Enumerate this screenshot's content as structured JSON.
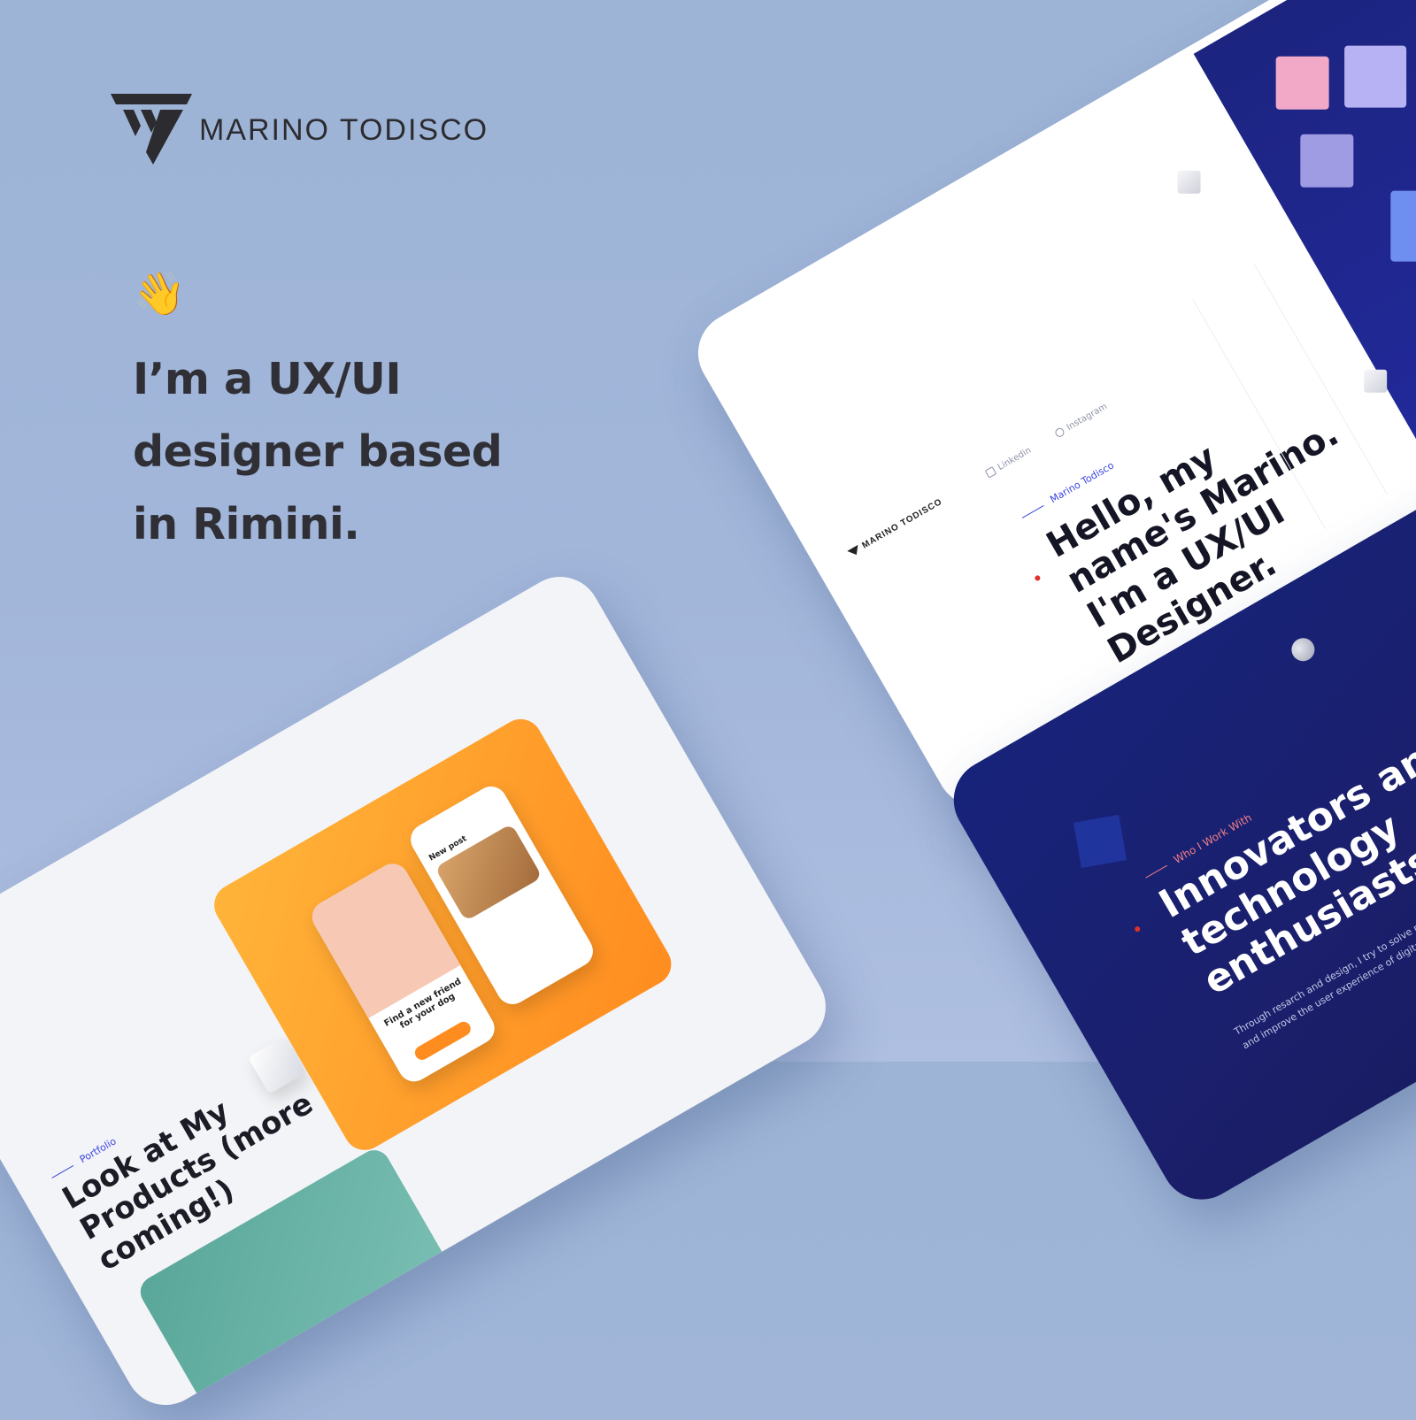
{
  "brand": {
    "name": "MARINO TODISCO"
  },
  "hero": {
    "wave_emoji": "👋",
    "headline_lines": [
      "I’m a UX/UI",
      "designer based",
      "in Rimini."
    ]
  },
  "hero_card": {
    "logo_text": "MARINO TODISCO",
    "links": [
      "Linkedin",
      "Instagram"
    ],
    "kicker": "Marino Todisco",
    "title": "Hello, my name's Marino. I'm a UX/UI Designer."
  },
  "dark_card": {
    "kicker": "Who I Work With",
    "title": "Innovators and technology enthusiasts.",
    "body": "Through resarch and design, I try to solve problems and improve the user experience of digital products"
  },
  "portfolio_card": {
    "kicker": "Portfolio",
    "title": "Look at My Products (more coming!)",
    "phone_left_text": "Find a new friend for your dog",
    "phone_right_text": "New post"
  },
  "colors": {
    "background": "#9db4d6",
    "accent_blue": "#3b45e0",
    "dark_navy": "#1b1f6b",
    "orange": "#ff8c1f",
    "red_dot": "#e0302c"
  },
  "icons": [
    "logo-mark-icon",
    "waving-hand-icon",
    "linkedin-icon",
    "instagram-icon"
  ]
}
